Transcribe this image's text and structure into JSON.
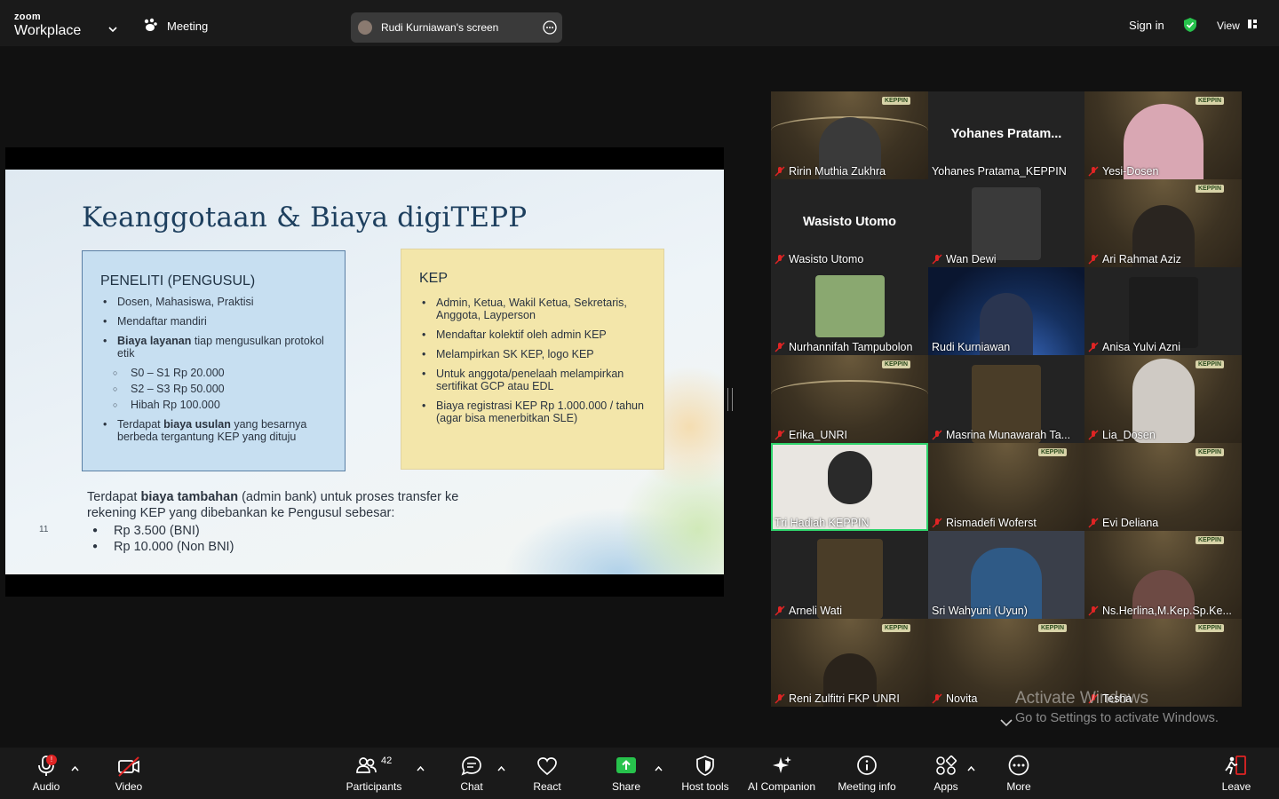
{
  "app": {
    "brand_small": "zoom",
    "brand_large": "Workplace",
    "meeting_label": "Meeting"
  },
  "screen_share": {
    "label": "Rudi Kurniawan's screen"
  },
  "topright": {
    "sign_in": "Sign in",
    "view": "View"
  },
  "slide": {
    "title": "Keanggotaan & Biaya digiTEPP",
    "left_box": {
      "heading": "PENELITI (PENGUSUL)",
      "items": [
        "Dosen, Mahasiswa, Praktisi",
        "Mendaftar mandiri",
        "tiap mengusulkan protokol etik",
        "S0 – S1 Rp 20.000",
        "S2 – S3 Rp 50.000",
        "Hibah Rp 100.000",
        "Terdapat",
        "yang besarnya berbeda tergantung KEP yang dituju"
      ],
      "bold_biaya_layanan": "Biaya layanan",
      "bold_biaya_usulan": "biaya usulan"
    },
    "right_box": {
      "heading": "KEP",
      "items": [
        "Admin, Ketua, Wakil Ketua, Sekretaris, Anggota, Layperson",
        "Mendaftar kolektif oleh admin KEP",
        "Melampirkan SK KEP, logo KEP",
        "Untuk anggota/penelaah melampirkan sertifikat GCP atau EDL",
        "Biaya registrasi KEP Rp 1.000.000 / tahun (agar bisa menerbitkan SLE)"
      ]
    },
    "bottom": {
      "pre": "Terdapat",
      "bold": "biaya tambahan",
      "post": "(admin bank) untuk proses  transfer ke rekening KEP yang dibebankan ke Pengusul sebesar:",
      "bullets": [
        "Rp 3.500 (BNI)",
        "Rp 10.000 (Non BNI)"
      ]
    },
    "page_number": "11"
  },
  "participants_gallery": [
    {
      "name": "Ririn Muthia Zukhra"
    },
    {
      "name": "Yohanes Pratama_KEPPIN",
      "big": "Yohanes  Pratam..."
    },
    {
      "name": "Yesi-Dosen"
    },
    {
      "name": "Wasisto Utomo",
      "big": "Wasisto Utomo"
    },
    {
      "name": "Wan Dewi"
    },
    {
      "name": "Ari Rahmat Aziz"
    },
    {
      "name": "Nurhannifah Tampubolon"
    },
    {
      "name": "Rudi Kurniawan"
    },
    {
      "name": "Anisa Yulvi Azni"
    },
    {
      "name": "Erika_UNRI"
    },
    {
      "name": "Masrina Munawarah Ta..."
    },
    {
      "name": "Lia_Dosen"
    },
    {
      "name": "Tri Hadiah KEPPIN"
    },
    {
      "name": "Rismadefi Woferst"
    },
    {
      "name": "Evi Deliana"
    },
    {
      "name": "Arneli Wati"
    },
    {
      "name": "Sri Wahyuni (Uyun)"
    },
    {
      "name": "Ns.Herlina,M.Kep.Sp.Ke..."
    },
    {
      "name": "Reni Zulfitri FKP UNRI"
    },
    {
      "name": "Novita"
    },
    {
      "name": "Tesha"
    }
  ],
  "tile_logo": "KEPPIN",
  "watermark": {
    "line1": "Activate Windows",
    "line2": "Go to Settings to activate Windows."
  },
  "toolbar": {
    "audio": "Audio",
    "audio_badge": "!",
    "video": "Video",
    "participants": "Participants",
    "participants_count": "42",
    "chat": "Chat",
    "react": "React",
    "share": "Share",
    "host_tools": "Host tools",
    "ai_companion": "AI Companion",
    "meeting_info": "Meeting info",
    "apps": "Apps",
    "more": "More",
    "leave": "Leave"
  },
  "colors": {
    "active_speaker": "#2fd36c",
    "share_green": "#27c24c",
    "leave_red": "#e02424",
    "mute_red": "#e02424"
  }
}
